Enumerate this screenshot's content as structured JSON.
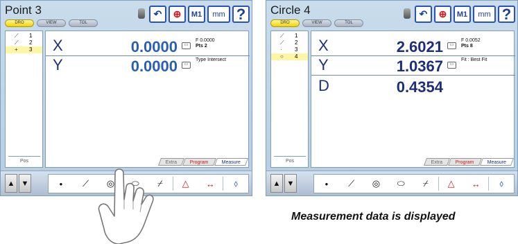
{
  "left": {
    "title": "Point 3",
    "modes": [
      "DRO",
      "VIEW",
      "TOL"
    ],
    "toolbar": {
      "undo_icon": "undo-icon",
      "probe_icon": "crosshair-icon",
      "m1": "M1",
      "mm": "mm",
      "help": "?"
    },
    "points": [
      {
        "num": "1",
        "icon": "line-icon"
      },
      {
        "num": "2",
        "icon": "line-icon"
      },
      {
        "num": "3",
        "icon": "point-icon"
      }
    ],
    "selected_point": "3",
    "pos_label": "Pos",
    "rows": [
      {
        "axis": "X",
        "value": "0.0000",
        "info1": "F  0.0000",
        "info2": "Pts 2"
      },
      {
        "axis": "Y",
        "value": "0.0000",
        "info1": "Type Intersect",
        "info2": ""
      }
    ],
    "tabs": [
      "Extra",
      "Program",
      "Measure"
    ]
  },
  "right": {
    "title": "Circle 4",
    "modes": [
      "DRO",
      "VIEW",
      "TOL"
    ],
    "toolbar": {
      "undo_icon": "undo-icon",
      "probe_icon": "crosshair-icon",
      "m1": "M1",
      "mm": "mm",
      "help": "?"
    },
    "points": [
      {
        "num": "1",
        "icon": "line-icon"
      },
      {
        "num": "2",
        "icon": "line-icon"
      },
      {
        "num": "3",
        "icon": "point-icon"
      },
      {
        "num": "4",
        "icon": "circle-icon"
      }
    ],
    "selected_point": "4",
    "pos_label": "Pos",
    "rows": [
      {
        "axis": "X",
        "value": "2.6021",
        "info1": "F  0.0052",
        "info2": "Pts 8"
      },
      {
        "axis": "Y",
        "value": "1.0367",
        "info1": "Fit : Best Fit",
        "info2": ""
      },
      {
        "axis": "D",
        "value": "0.4354",
        "info1": "",
        "info2": ""
      }
    ],
    "tabs": [
      "Extra",
      "Program",
      "Measure"
    ]
  },
  "feature_tools": [
    "point-icon",
    "line-icon",
    "circle-icon",
    "slot-icon",
    "distance-icon",
    "angle-icon",
    "width-icon",
    "skew-icon"
  ],
  "caption": "Measurement data is displayed"
}
